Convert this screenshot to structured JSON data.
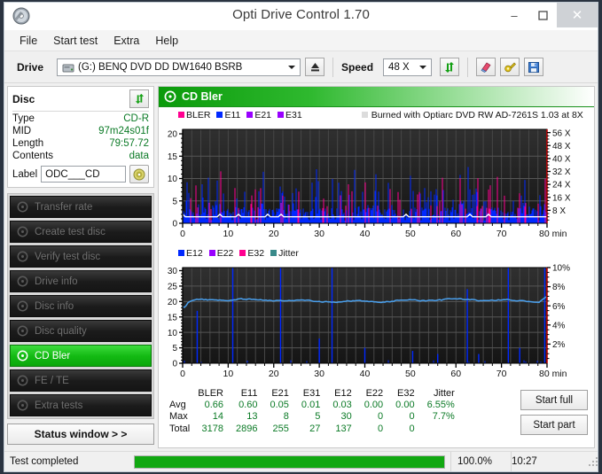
{
  "window": {
    "title": "Opti Drive Control 1.70",
    "icon": "disc-icon",
    "minimize": "–",
    "maximize": "❐",
    "close": "✕"
  },
  "menu": {
    "items": [
      "File",
      "Start test",
      "Extra",
      "Help"
    ]
  },
  "toolbar": {
    "drive_label": "Drive",
    "drive_value": "(G:)   BENQ DVD DD DW1640 BSRB",
    "eject_icon": "eject-icon",
    "speed_label": "Speed",
    "speed_value": "48 X",
    "refresh_icon": "refresh-icon",
    "erase_icon": "eraser-icon",
    "tools_icon": "wrench-icon",
    "save_icon": "save-icon"
  },
  "disc": {
    "title": "Disc",
    "refresh_icon": "refresh-icon",
    "rows": [
      {
        "key": "Type",
        "value": "CD-R"
      },
      {
        "key": "MID",
        "value": "97m24s01f"
      },
      {
        "key": "Length",
        "value": "79:57.72"
      },
      {
        "key": "Contents",
        "value": "data"
      }
    ],
    "label_key": "Label",
    "label_value": "ODC___CD",
    "label_icon": "cd-icon"
  },
  "nav": {
    "items": [
      {
        "label": "Transfer rate",
        "icon": "disc-icon",
        "active": false
      },
      {
        "label": "Create test disc",
        "icon": "disc-icon",
        "active": false
      },
      {
        "label": "Verify test disc",
        "icon": "disc-icon",
        "active": false
      },
      {
        "label": "Drive info",
        "icon": "disc-icon",
        "active": false
      },
      {
        "label": "Disc info",
        "icon": "disc-icon",
        "active": false
      },
      {
        "label": "Disc quality",
        "icon": "disc-icon",
        "active": false
      },
      {
        "label": "CD Bler",
        "icon": "disc-icon",
        "active": true
      },
      {
        "label": "FE / TE",
        "icon": "disc-icon",
        "active": false
      },
      {
        "label": "Extra tests",
        "icon": "disc-icon",
        "active": false
      }
    ],
    "status_window": "Status window > >"
  },
  "panel": {
    "title": "CD Bler",
    "icon": "disc-icon"
  },
  "burn_info": "Burned with Optiarc DVD RW AD-7261S 1.03 at 8X",
  "colors": {
    "bler": "#ff0090",
    "e11": "#0028ff",
    "e21": "#9900ff",
    "e31": "#9900ff",
    "e12": "#0028ff",
    "e22": "#9900ff",
    "e32": "#ff0090",
    "jitter": "#3a8a8a",
    "jitter_line": "#4aa0ee",
    "speed_line": "#ffffff",
    "accent_green": "#11a811",
    "value_green": "#0b7a26"
  },
  "chart_data": [
    {
      "type": "line",
      "name": "CD Bler errors",
      "title": "",
      "xlabel": "min",
      "ylabel": "",
      "x": [
        0,
        80
      ],
      "xlim": [
        0,
        80
      ],
      "xticks": [
        0,
        10,
        20,
        30,
        40,
        50,
        60,
        70,
        80
      ],
      "xticklabels": [
        "0",
        "10",
        "20",
        "30",
        "40",
        "50",
        "60",
        "70",
        "80 min"
      ],
      "ylim": [
        0,
        21
      ],
      "yticks": [
        0,
        5,
        10,
        15,
        20
      ],
      "yticklabels": [
        "0",
        "5",
        "10",
        "15",
        "20"
      ],
      "y2lim": [
        0,
        58
      ],
      "y2ticks": [
        8,
        16,
        24,
        32,
        40,
        48,
        56
      ],
      "y2ticklabels": [
        "8 X",
        "16 X",
        "24 X",
        "32 X",
        "40 X",
        "48 X",
        "56 X"
      ],
      "grid": true,
      "legend": [
        {
          "name": "BLER",
          "color": "#ff0090"
        },
        {
          "name": "E11",
          "color": "#0028ff"
        },
        {
          "name": "E21",
          "color": "#9900ff"
        },
        {
          "name": "E31",
          "color": "#9900ff"
        }
      ],
      "annotation": "Burned with Optiarc DVD RW AD-7261S 1.03 at 8X",
      "series": [
        {
          "name": "BLER",
          "color": "#ff0090",
          "avg": 0.66,
          "max": 14,
          "total": 3178
        },
        {
          "name": "E11",
          "color": "#0028ff",
          "avg": 0.6,
          "max": 13,
          "total": 2896
        },
        {
          "name": "E21",
          "color": "#9900ff",
          "avg": 0.05,
          "max": 8,
          "total": 255
        },
        {
          "name": "E31",
          "color": "#9900ff",
          "avg": 0.01,
          "max": 5,
          "total": 27
        },
        {
          "name": "Read speed",
          "color": "#ffffff",
          "axis": "right",
          "values": [
            4,
            4,
            4,
            4,
            4,
            4,
            4,
            4,
            4,
            4,
            4,
            4,
            4,
            4,
            4,
            4,
            4,
            4,
            4,
            4,
            4,
            4,
            4,
            4,
            4,
            4,
            4,
            4,
            4,
            4,
            4,
            4,
            4
          ]
        }
      ]
    },
    {
      "type": "line",
      "name": "CD Bler jitter",
      "title": "",
      "xlabel": "min",
      "ylabel": "",
      "xlim": [
        0,
        80
      ],
      "xticks": [
        0,
        10,
        20,
        30,
        40,
        50,
        60,
        70,
        80
      ],
      "xticklabels": [
        "0",
        "10",
        "20",
        "30",
        "40",
        "50",
        "60",
        "70",
        "80 min"
      ],
      "ylim": [
        0,
        31
      ],
      "yticks": [
        0,
        5,
        10,
        15,
        20,
        25,
        30
      ],
      "yticklabels": [
        "0",
        "5",
        "10",
        "15",
        "20",
        "25",
        "30"
      ],
      "y2lim": [
        0,
        10
      ],
      "y2ticks": [
        2,
        4,
        6,
        8,
        10
      ],
      "y2ticklabels": [
        "2%",
        "4%",
        "6%",
        "8%",
        "10%"
      ],
      "grid": true,
      "legend": [
        {
          "name": "E12",
          "color": "#0028ff"
        },
        {
          "name": "E22",
          "color": "#9900ff"
        },
        {
          "name": "E32",
          "color": "#ff0090"
        },
        {
          "name": "Jitter",
          "color": "#3a8a8a"
        }
      ],
      "series": [
        {
          "name": "E12",
          "color": "#0028ff",
          "avg": 0.03,
          "max": 30,
          "total": 137
        },
        {
          "name": "E22",
          "color": "#9900ff",
          "avg": 0.0,
          "max": 0,
          "total": 0
        },
        {
          "name": "E32",
          "color": "#ff0090",
          "avg": 0.0,
          "max": 0,
          "total": 0
        },
        {
          "name": "Jitter",
          "color": "#4aa0ee",
          "axis": "right",
          "avg": "6.55%",
          "max": "7.7%",
          "values": [
            6.5,
            6.7,
            6.8,
            6.7,
            6.6,
            6.6,
            6.7,
            6.6,
            6.6,
            6.8,
            6.9,
            6.8,
            6.7,
            6.7,
            6.8,
            6.9,
            6.7,
            6.6,
            6.5,
            6.5,
            6.6,
            6.5,
            6.5,
            6.5,
            6.6,
            6.5,
            6.5,
            6.6,
            6.7,
            6.8,
            6.6,
            6.5,
            6.5,
            6.6,
            6.5,
            6.5,
            6.6,
            6.7,
            6.6,
            6.5,
            6.6,
            6.7,
            6.8,
            6.9,
            6.8,
            6.7
          ]
        }
      ]
    }
  ],
  "stats": {
    "columns": [
      "BLER",
      "E11",
      "E21",
      "E31",
      "E12",
      "E22",
      "E32",
      "Jitter"
    ],
    "rows": [
      {
        "label": "Avg",
        "values": [
          "0.66",
          "0.60",
          "0.05",
          "0.01",
          "0.03",
          "0.00",
          "0.00",
          "6.55%"
        ]
      },
      {
        "label": "Max",
        "values": [
          "14",
          "13",
          "8",
          "5",
          "30",
          "0",
          "0",
          "7.7%"
        ]
      },
      {
        "label": "Total",
        "values": [
          "3178",
          "2896",
          "255",
          "27",
          "137",
          "0",
          "0",
          ""
        ]
      }
    ]
  },
  "actions": {
    "start_full": "Start full",
    "start_part": "Start part"
  },
  "statusbar": {
    "message": "Test completed",
    "percent_label": "100.0%",
    "percent_value": 100,
    "time": "10:27"
  }
}
